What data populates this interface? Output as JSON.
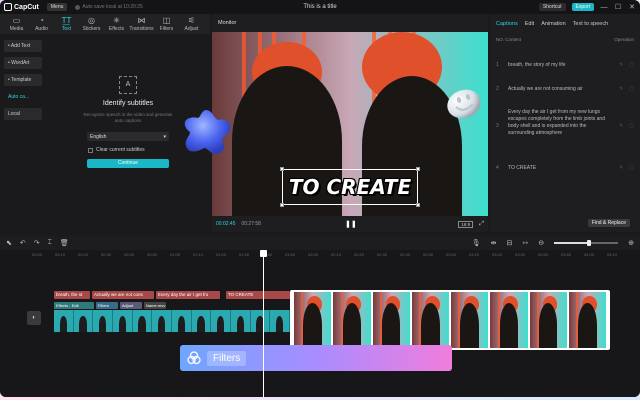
{
  "app": {
    "name": "CapCut",
    "title": "This is a title"
  },
  "titlebar": {
    "menu_label": "Menu",
    "autosave": "Auto save local at 10:20:25",
    "shortcut_label": "Shortcut",
    "export_label": "Export",
    "minimize": "—",
    "maximize": "☐",
    "close": "✕"
  },
  "toolbar": {
    "tools": [
      {
        "label": "Media",
        "icon": "media-icon",
        "glyph": "▭"
      },
      {
        "label": "Audio",
        "icon": "audio-icon",
        "glyph": "◔"
      },
      {
        "label": "Text",
        "icon": "text-icon",
        "glyph": "T͟T"
      },
      {
        "label": "Stickers",
        "icon": "stickers-icon",
        "glyph": "◎"
      },
      {
        "label": "Effects",
        "icon": "effects-icon",
        "glyph": "✳"
      },
      {
        "label": "Transitions",
        "icon": "transitions-icon",
        "glyph": "⋈"
      },
      {
        "label": "Filters",
        "icon": "filters-icon",
        "glyph": "◫"
      },
      {
        "label": "Adjust",
        "icon": "adjust-icon",
        "glyph": "⚟"
      }
    ],
    "active_index": 2
  },
  "leftnav": {
    "items": [
      "• Add Text",
      "• WordArt",
      "• Template",
      "Auto ca...",
      "Local"
    ]
  },
  "subtitle_panel": {
    "icon_glyph": "A",
    "title": "Identify subtitles",
    "description": "Recognize speech in the video and generate auto captions",
    "language": "English",
    "clear_label": "Clear current subtitles",
    "continue_label": "Continue"
  },
  "monitor": {
    "label": "Monitor",
    "caption": "TO CREATE",
    "current_time": "00:02:45",
    "total_time": "00:27:58",
    "ratio": "16:9"
  },
  "right_panel": {
    "tabs": [
      "Captions",
      "Edit",
      "Animation",
      "Text to speech"
    ],
    "active_tab": 0,
    "col_no": "NO.",
    "col_content": "Content",
    "col_operation": "Operation",
    "captions": [
      {
        "no": "1",
        "text": "breath, the story of my life"
      },
      {
        "no": "2",
        "text": "Actually we are not consuming air"
      },
      {
        "no": "3",
        "text": "Every day the air I get from my new lungs escapes completely from the limb joints and body shell and is expanded into the surrounding atmosphere"
      },
      {
        "no": "4",
        "text": "TO CREATE"
      }
    ],
    "find_replace": "Find & Replace"
  },
  "timeline": {
    "ticks": [
      "00:00",
      "00:10",
      "00:20",
      "00:30",
      "00:40",
      "00:50",
      "01:00",
      "01:10",
      "01:20",
      "01:30",
      "01:40",
      "01:50",
      "02:00",
      "02:10",
      "02:20",
      "02:30",
      "02:40",
      "02:50",
      "03:00",
      "03:10",
      "03:20",
      "03:30",
      "03:40",
      "03:50",
      "04:00",
      "04:10"
    ],
    "caption_clips": [
      "breath, the st",
      "Actually we are not cons",
      "Every day the air I get fro",
      "TO CREATE"
    ],
    "fx_labels": {
      "effects": "Effects - Edit",
      "filters": "Filters",
      "adjust": "Adjust",
      "name": "Name.mov"
    },
    "filters_card": "Filters",
    "zoom_level": 0.55
  },
  "colors": {
    "accent": "#2fd3dd",
    "export": "#1bb7c6",
    "caption_clip": "#a84848"
  }
}
